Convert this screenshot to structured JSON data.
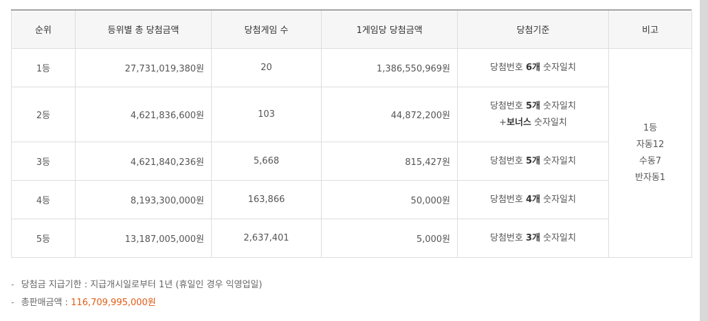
{
  "table": {
    "headers": [
      "순위",
      "등위별 총 당첨금액",
      "당첨게임 수",
      "1게임당 당첨금액",
      "당첨기준",
      "비고"
    ],
    "rows": [
      {
        "rank": "1등",
        "total": "27,731,019,380원",
        "games": "20",
        "per_game": "1,386,550,969원",
        "criteria": {
          "prefix": "당첨번호 ",
          "bold": "6개",
          "suffix": " 숫자일치"
        }
      },
      {
        "rank": "2등",
        "total": "4,621,836,600원",
        "games": "103",
        "per_game": "44,872,200원",
        "criteria": {
          "prefix": "당첨번호 ",
          "bold": "5개",
          "suffix": " 숫자일치"
        },
        "criteria2": {
          "prefix": "+",
          "bold": "보너스",
          "suffix": " 숫자일치"
        }
      },
      {
        "rank": "3등",
        "total": "4,621,840,236원",
        "games": "5,668",
        "per_game": "815,427원",
        "criteria": {
          "prefix": "당첨번호 ",
          "bold": "5개",
          "suffix": " 숫자일치"
        }
      },
      {
        "rank": "4등",
        "total": "8,193,300,000원",
        "games": "163,866",
        "per_game": "50,000원",
        "criteria": {
          "prefix": "당첨번호 ",
          "bold": "4개",
          "suffix": " 숫자일치"
        }
      },
      {
        "rank": "5등",
        "total": "13,187,005,000원",
        "games": "2,637,401",
        "per_game": "5,000원",
        "criteria": {
          "prefix": "당첨번호 ",
          "bold": "3개",
          "suffix": " 숫자일치"
        }
      }
    ],
    "note": [
      "1등",
      "자동12",
      "수동7",
      "반자동1"
    ]
  },
  "footnotes": {
    "dash": "-",
    "deadline_label": "당첨금 지급기한 : ",
    "deadline_value": "지급개시일로부터 1년 (휴일인 경우 익영업일)",
    "sales_label": "총판매금액 : ",
    "sales_value": "116,709,995,000원"
  },
  "colors": {
    "amount": "#e05b14",
    "header_bg": "#f6f6f6",
    "border": "#dddddd",
    "outer_bg": "#d9d9d9"
  }
}
